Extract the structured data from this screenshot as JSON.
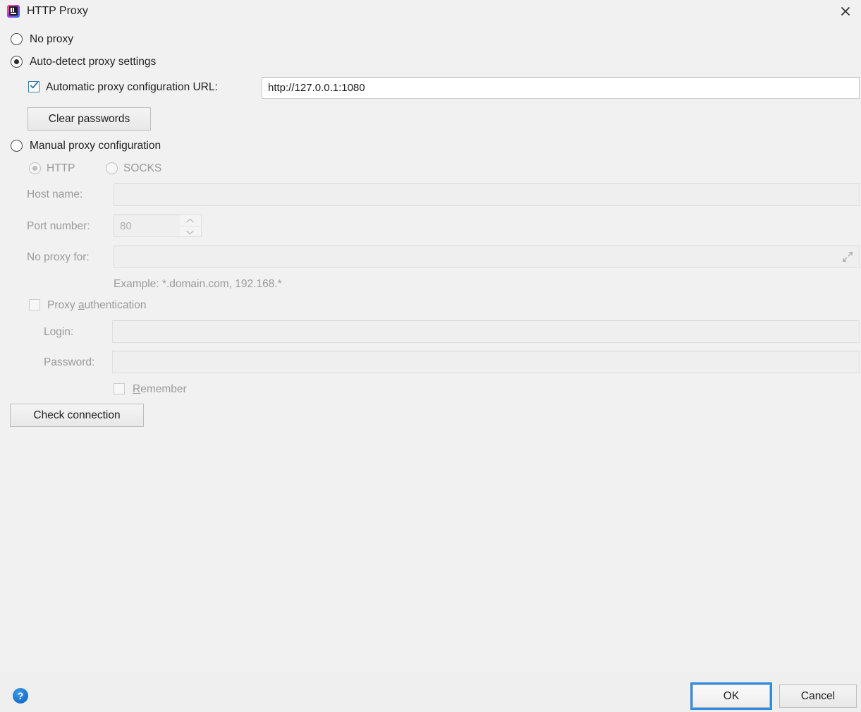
{
  "window": {
    "title": "HTTP Proxy",
    "icon": "intellij-idea-logo-icon",
    "close_label": "✕"
  },
  "options": {
    "no_proxy": {
      "label": "No proxy",
      "selected": false
    },
    "auto_detect": {
      "label": "Auto-detect proxy settings",
      "selected": true
    },
    "manual": {
      "label": "Manual proxy configuration",
      "selected": false
    }
  },
  "auto_section": {
    "pac_checkbox_label": "Automatic proxy configuration URL:",
    "pac_checked": true,
    "pac_url_value": "http://127.0.0.1:1080",
    "clear_passwords_label": "Clear passwords"
  },
  "manual_section": {
    "protocol": {
      "http_label": "HTTP",
      "http_selected": true,
      "socks_label": "SOCKS",
      "socks_selected": false
    },
    "host_name_label": "Host name:",
    "host_name_value": "",
    "port_number_label": "Port number:",
    "port_number_value": "80",
    "no_proxy_for_label": "No proxy for:",
    "no_proxy_for_value": "",
    "example_text": "Example: *.domain.com, 192.168.*",
    "expand_icon": "expand-arrows-icon"
  },
  "auth_section": {
    "proxy_auth_label_pre": "Proxy ",
    "proxy_auth_label_mnemonic": "a",
    "proxy_auth_label_post": "uthentication",
    "proxy_auth_checked": false,
    "login_label": "Login:",
    "login_value": "",
    "password_label": "Password:",
    "password_value": "",
    "remember_label_mnemonic": "R",
    "remember_label_post": "emember",
    "remember_checked": false
  },
  "actions": {
    "check_connection_label": "Check connection"
  },
  "footer": {
    "help_label": "?",
    "ok_label": "OK",
    "cancel_label": "Cancel"
  },
  "colors": {
    "background": "#f1f1f1",
    "accent_focus": "#2f8ce0",
    "checkbox_blue": "#3c7fb1",
    "help_blue": "#1a74d0",
    "disabled_text": "#9a9a9a"
  }
}
